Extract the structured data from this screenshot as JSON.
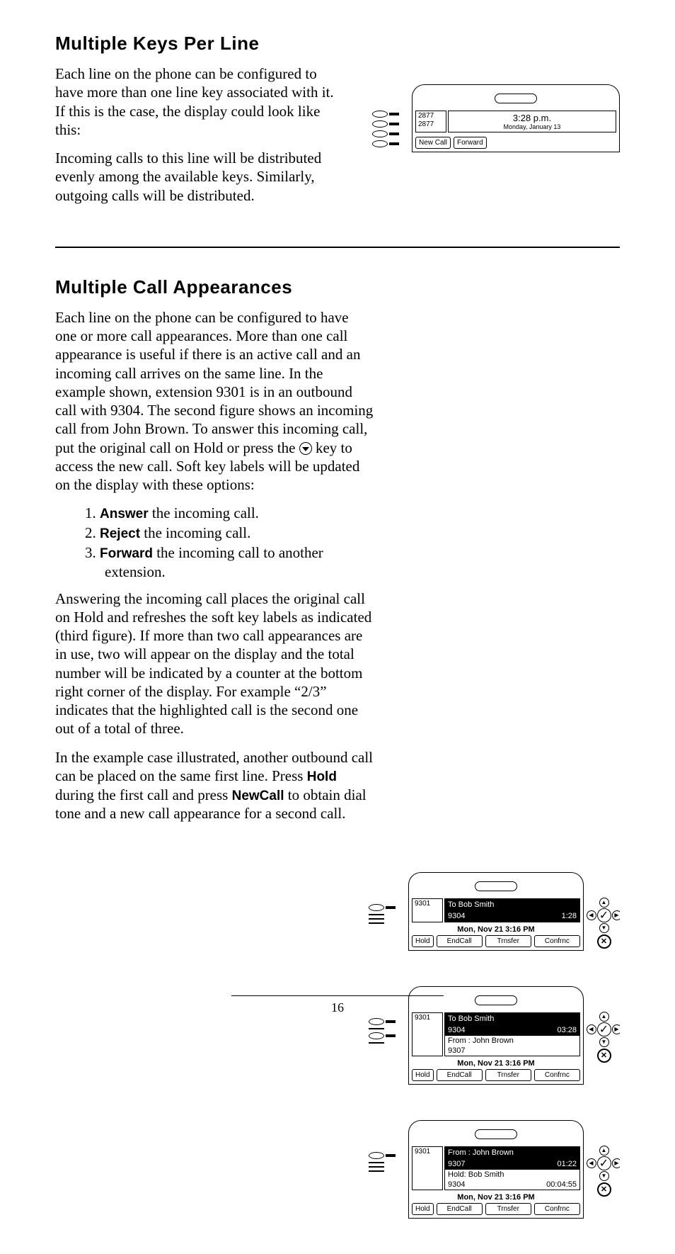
{
  "sec1": {
    "heading": "Multiple Keys Per Line",
    "p1": "Each line on the phone can be configured to have more than one line key associated with it.  If this is the case, the display could look like this:",
    "p2": "Incoming calls to this line will be distributed evenly among the available keys.  Similarly, outgoing calls will be distributed."
  },
  "fig1": {
    "ext1": "2877",
    "ext2": "2877",
    "time": "3:28 p.m.",
    "date": "Monday, January 13",
    "sk1": "New Call",
    "sk2": "Forward"
  },
  "sec2": {
    "heading": "Multiple Call Appearances",
    "p1": "Each line on the phone can be configured to have one or more call appearances.  More than one call appearance is useful if there is an active call and an incoming call arrives on the same line.  In the example shown, extension 9301 is in an outbound call with 9304.  The second figure shows an incoming call from John Brown.  To answer this incoming call, put the original call on Hold or press the ",
    "p1b": " key to access the new call.  Soft key labels will be updated on the display with these options:",
    "li1_pre": "1.  ",
    "li1_bold": "Answer",
    "li1_post": " the incoming call.",
    "li2_pre": "2.  ",
    "li2_bold": "Reject",
    "li2_post": " the incoming call.",
    "li3_pre": "3.  ",
    "li3_bold": "Forward",
    "li3_post": " the incoming call to another extension.",
    "p2": "Answering the incoming call places the original call on Hold and refreshes the soft key labels as indicated (third figure).  If more than two call appearances are in use, two will appear on the display and the total number will be indicated by a counter at the bottom right corner of the display.  For example “2/3” indicates that the highlighted call is the second one out of a total of three.",
    "p3a": "In the example case illustrated,  another outbound call can be placed on the same first line.  Press ",
    "p3_hold": "Hold",
    "p3b": " during the first call and press ",
    "p3_new": "NewCall",
    "p3c": " to obtain dial tone and a new call appearance for a second call."
  },
  "figA": {
    "ext": "9301",
    "to": "To Bob Smith",
    "num": "9304",
    "dur": "1:28",
    "date": "Mon, Nov 21  3:16 PM",
    "sk0": "Hold",
    "sk1": "EndCall",
    "sk2": "Trnsfer",
    "sk3": "Confrnc"
  },
  "figB": {
    "ext": "9301",
    "to": "To Bob Smith",
    "num": "9304",
    "dur": "03:28",
    "from": "From : John Brown",
    "from_num": "9307",
    "date": "Mon, Nov 21  3:16 PM",
    "sk0": "Hold",
    "sk1": "EndCall",
    "sk2": "Trnsfer",
    "sk3": "Confrnc"
  },
  "figC": {
    "ext": "9301",
    "from": "From : John Brown",
    "from_num": "9307",
    "from_dur": "01:22",
    "hold": "Hold: Bob Smith",
    "hold_num": "9304",
    "hold_dur": "00:04:55",
    "date": "Mon, Nov 21  3:16 PM",
    "sk0": "Hold",
    "sk1": "EndCall",
    "sk2": "Trnsfer",
    "sk3": "Confrnc"
  },
  "pagenum": "16"
}
